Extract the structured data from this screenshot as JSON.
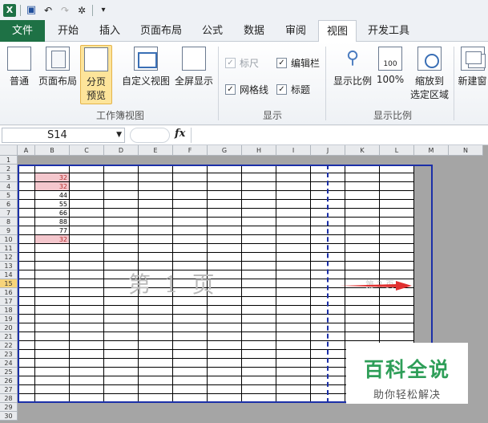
{
  "tabs": [
    "文件",
    "开始",
    "插入",
    "页面布局",
    "公式",
    "数据",
    "审阅",
    "视图",
    "开发工具"
  ],
  "active_tab": "视图",
  "ribbon": {
    "workbook_views": {
      "label": "工作簿视图",
      "normal": "普通",
      "page_layout": "页面布局",
      "page_break_1": "分页",
      "page_break_2": "预览",
      "custom_views": "自定义视图",
      "full_screen": "全屏显示"
    },
    "show": {
      "label": "显示",
      "ruler": "标尺",
      "formula_bar": "编辑栏",
      "gridlines": "网格线",
      "headings": "标题"
    },
    "zoom": {
      "label": "显示比例",
      "zoom": "显示比例",
      "hundred": "100%",
      "icon_text": "100",
      "fit_selection_1": "缩放到",
      "fit_selection_2": "选定区域"
    },
    "window": {
      "new_window": "新建窗"
    }
  },
  "formula_bar": {
    "name_box": "S14",
    "fx": "fx",
    "value": ""
  },
  "sheet": {
    "columns": [
      "A",
      "B",
      "C",
      "D",
      "E",
      "F",
      "G",
      "H",
      "I",
      "J",
      "K",
      "L",
      "M",
      "N"
    ],
    "rows": [
      "1",
      "2",
      "3",
      "4",
      "5",
      "6",
      "7",
      "8",
      "9",
      "10",
      "11",
      "12",
      "13",
      "14",
      "15",
      "16",
      "17",
      "18",
      "19",
      "20",
      "21",
      "22",
      "23",
      "24",
      "25",
      "26",
      "27",
      "28",
      "29",
      "30"
    ],
    "column_b_values": [
      {
        "row": 3,
        "value": "32",
        "highlight": true
      },
      {
        "row": 4,
        "value": "32",
        "highlight": true
      },
      {
        "row": 5,
        "value": "44",
        "highlight": false
      },
      {
        "row": 6,
        "value": "55",
        "highlight": false
      },
      {
        "row": 7,
        "value": "66",
        "highlight": false
      },
      {
        "row": 8,
        "value": "88",
        "highlight": false
      },
      {
        "row": 9,
        "value": "77",
        "highlight": false
      },
      {
        "row": 10,
        "value": "32",
        "highlight": true
      }
    ],
    "page1_watermark": "第 1 页",
    "page2_watermark": "第 2 页",
    "selected_row": "15",
    "highlight_color": "#f4c7cd",
    "page_border_color": "#1b2fa8"
  },
  "logo": {
    "title": "百科全说",
    "subtitle": "助你轻松解决"
  }
}
